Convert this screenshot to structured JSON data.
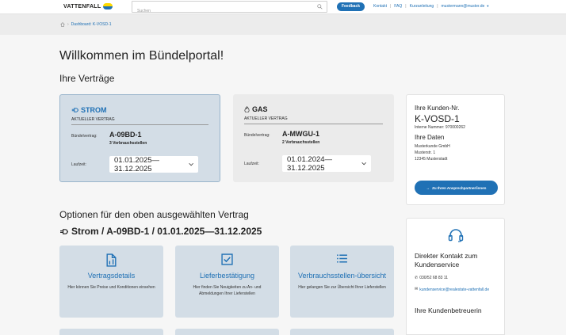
{
  "header": {
    "logo_text": "VATTENFALL",
    "search_placeholder": "Suchen",
    "feedback_label": "Feedback",
    "links": [
      "Kontakt",
      "FAQ",
      "Kurzanleitung"
    ],
    "user_email": "mustermann@muster.de"
  },
  "breadcrumb": {
    "label": "Dashboard: K-VOSD-1"
  },
  "page": {
    "title": "Willkommen im Bündelportal!",
    "contracts_heading": "Ihre Verträge",
    "options_heading": "Optionen für den oben ausgewählten Vertrag",
    "selected_contract": "Strom / A-09BD-1 / 01.01.2025—31.12.2025"
  },
  "contracts": [
    {
      "type": "STROM",
      "status": "AKTUELLER VERTRAG",
      "bundle_label": "Bündelvertrag:",
      "bundle_number": "A-09BD-1",
      "points": "3 Verbrauchsstellen",
      "term_label": "Laufzeit:",
      "term_value": "01.01.2025—31.12.2025"
    },
    {
      "type": "GAS",
      "status": "AKTUELLER VERTRAG",
      "bundle_label": "Bündelvertrag:",
      "bundle_number": "A-MWGU-1",
      "points": "2 Verbrauchsstellen",
      "term_label": "Laufzeit:",
      "term_value": "01.01.2024—31.12.2025"
    }
  ],
  "customer": {
    "heading": "Ihre Kunden-Nr.",
    "number": "K-VOSD-1",
    "internal": "Interne Nummer: 970000262",
    "data_heading": "Ihre Daten",
    "company": "Musterkunde GmbH",
    "street": "Musterstr. 1",
    "city": "12345 Musterstadt",
    "button_label": "Zu Ihren Ansprechpartner/innen"
  },
  "options": [
    {
      "title": "Vertragsdetails",
      "desc": "Hier können Sie Preise und Konditionen einsehen",
      "icon": "document-icon"
    },
    {
      "title": "Lieferbestätigung",
      "desc": "Hier finden Sie Neuigkeiten zu An- und Abmeldungen Ihrer Lieferstellen",
      "icon": "checkbox-icon"
    },
    {
      "title": "Verbrauchsstellen-übersicht",
      "desc": "Hier gelangen Sie zur Übersicht Ihrer Lieferstellen",
      "icon": "list-icon"
    }
  ],
  "contact": {
    "title": "Direkter Kontakt zum Kundenservice",
    "phone": "030/52 68 83 11",
    "email": "kundenservice@realestate-vattenfall.de",
    "advisor_heading": "Ihre Kundenbetreuerin"
  },
  "colors": {
    "brand_blue": "#2071b5",
    "card_blue": "#d3dde6",
    "logo_yellow": "#ffda00"
  }
}
